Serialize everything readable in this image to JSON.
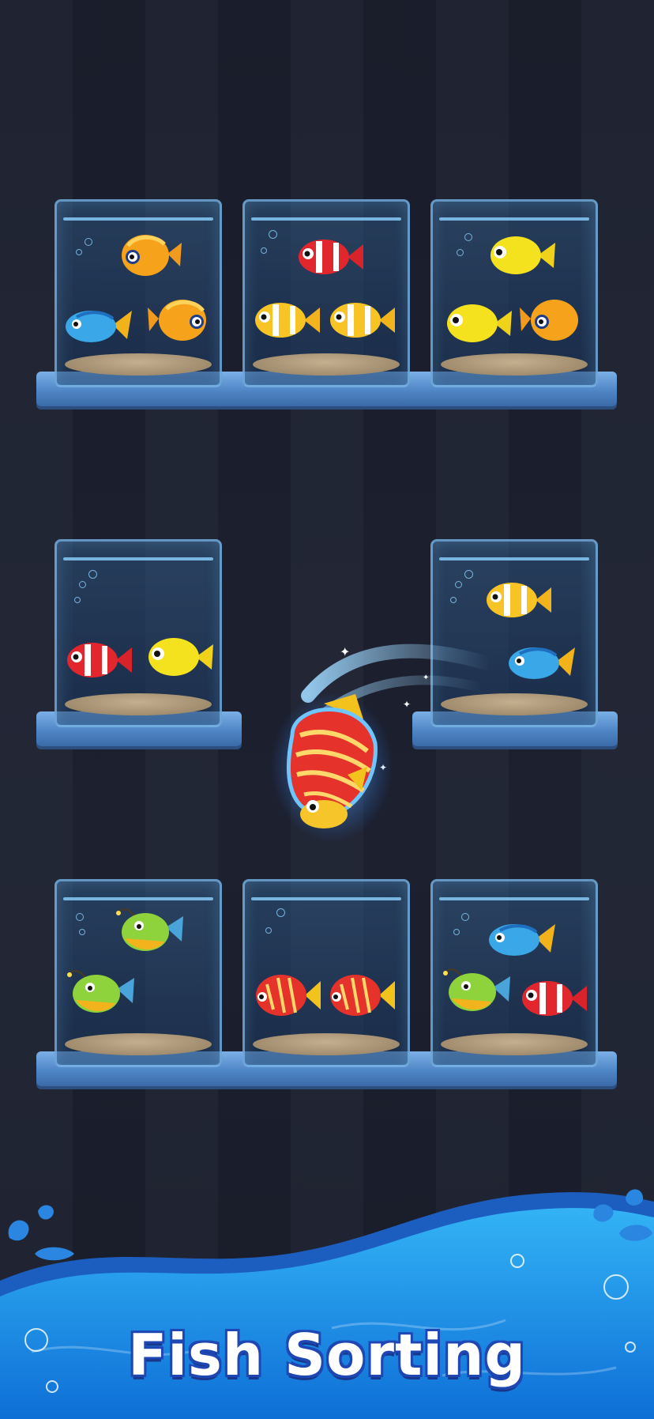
{
  "game": {
    "title": "Fish Sorting"
  },
  "tanks": [
    {
      "name": "tank-top-left",
      "fish": [
        "orange-butterflyfish",
        "blue-tang",
        "orange-butterflyfish"
      ]
    },
    {
      "name": "tank-top-middle",
      "fish": [
        "red-clownfish",
        "yellow-clownfish",
        "yellow-clownfish"
      ]
    },
    {
      "name": "tank-top-right",
      "fish": [
        "yellow-tang",
        "yellow-tang",
        "orange-butterflyfish"
      ]
    },
    {
      "name": "tank-middle-left",
      "fish": [
        "red-clownfish",
        "yellow-tang"
      ]
    },
    {
      "name": "tank-middle-right",
      "fish": [
        "yellow-clownfish",
        "blue-tang"
      ]
    },
    {
      "name": "tank-bottom-left",
      "fish": [
        "green-anglerfish",
        "green-anglerfish"
      ]
    },
    {
      "name": "tank-bottom-middle",
      "fish": [
        "red-striped-fish",
        "red-striped-fish"
      ]
    },
    {
      "name": "tank-bottom-right",
      "fish": [
        "blue-tang",
        "green-anglerfish",
        "red-clownfish"
      ]
    }
  ],
  "moving_fish": "red-striped-fish",
  "colors": {
    "background": "#1b1f2d",
    "shelf": "#5a8fd0",
    "water_banner": "#1f8fe6",
    "title_outline": "#1f47b3"
  }
}
